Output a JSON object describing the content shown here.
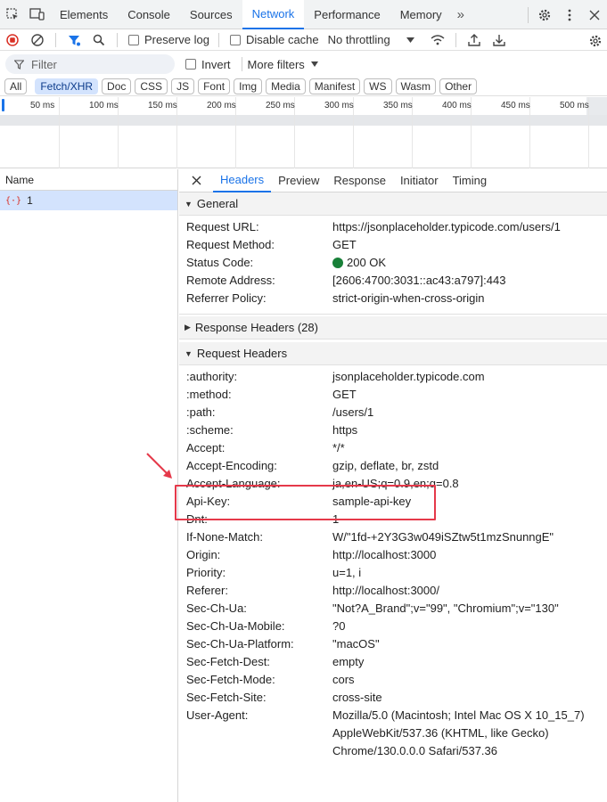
{
  "devtools": {
    "tabs": [
      "Elements",
      "Console",
      "Sources",
      "Network",
      "Performance",
      "Memory"
    ],
    "active_tab": "Network",
    "more_tabs": "»"
  },
  "toolbar": {
    "preserve_log": "Preserve log",
    "disable_cache": "Disable cache",
    "throttling": "No throttling"
  },
  "filter": {
    "placeholder": "Filter",
    "invert": "Invert",
    "more_filters": "More filters"
  },
  "type_chips": [
    "All",
    "Fetch/XHR",
    "Doc",
    "CSS",
    "JS",
    "Font",
    "Img",
    "Media",
    "Manifest",
    "WS",
    "Wasm",
    "Other"
  ],
  "active_chip": "Fetch/XHR",
  "timeline": {
    "ticks": [
      "50 ms",
      "100 ms",
      "150 ms",
      "200 ms",
      "250 ms",
      "300 ms",
      "350 ms",
      "400 ms",
      "450 ms",
      "500 ms"
    ]
  },
  "request_list": {
    "column": "Name",
    "rows": [
      {
        "name": "1"
      }
    ]
  },
  "detail": {
    "tabs": [
      "Headers",
      "Preview",
      "Response",
      "Initiator",
      "Timing"
    ],
    "active_tab": "Headers",
    "general": {
      "title": "General",
      "rows": [
        {
          "key": "Request URL:",
          "value": "https://jsonplaceholder.typicode.com/users/1"
        },
        {
          "key": "Request Method:",
          "value": "GET"
        },
        {
          "key": "Status Code:",
          "value": "200 OK"
        },
        {
          "key": "Remote Address:",
          "value": "[2606:4700:3031::ac43:a797]:443"
        },
        {
          "key": "Referrer Policy:",
          "value": "strict-origin-when-cross-origin"
        }
      ]
    },
    "response_headers": {
      "title": "Response Headers (28)"
    },
    "request_headers": {
      "title": "Request Headers",
      "rows": [
        {
          "key": ":authority:",
          "value": "jsonplaceholder.typicode.com"
        },
        {
          "key": ":method:",
          "value": "GET"
        },
        {
          "key": ":path:",
          "value": "/users/1"
        },
        {
          "key": ":scheme:",
          "value": "https"
        },
        {
          "key": "Accept:",
          "value": "*/*"
        },
        {
          "key": "Accept-Encoding:",
          "value": "gzip, deflate, br, zstd"
        },
        {
          "key": "Accept-Language:",
          "value": "ja,en-US;q=0.9,en;q=0.8"
        },
        {
          "key": "Api-Key:",
          "value": "sample-api-key"
        },
        {
          "key": "Dnt:",
          "value": "1"
        },
        {
          "key": "If-None-Match:",
          "value": "W/\"1fd-+2Y3G3w049iSZtw5t1mzSnunngE\""
        },
        {
          "key": "Origin:",
          "value": "http://localhost:3000"
        },
        {
          "key": "Priority:",
          "value": "u=1, i"
        },
        {
          "key": "Referer:",
          "value": "http://localhost:3000/"
        },
        {
          "key": "Sec-Ch-Ua:",
          "value": "\"Not?A_Brand\";v=\"99\", \"Chromium\";v=\"130\""
        },
        {
          "key": "Sec-Ch-Ua-Mobile:",
          "value": "?0"
        },
        {
          "key": "Sec-Ch-Ua-Platform:",
          "value": "\"macOS\""
        },
        {
          "key": "Sec-Fetch-Dest:",
          "value": "empty"
        },
        {
          "key": "Sec-Fetch-Mode:",
          "value": "cors"
        },
        {
          "key": "Sec-Fetch-Site:",
          "value": "cross-site"
        },
        {
          "key": "User-Agent:",
          "value": "Mozilla/5.0 (Macintosh; Intel Mac OS X 10_15_7)"
        },
        {
          "key": "",
          "value": "AppleWebKit/537.36 (KHTML, like Gecko)"
        },
        {
          "key": "",
          "value": "Chrome/130.0.0.0 Safari/537.36"
        }
      ]
    }
  },
  "colors": {
    "accent": "#1a73e8",
    "highlight": "#e5394a",
    "status_ok": "#188038",
    "selected_row": "#d3e3fd"
  }
}
